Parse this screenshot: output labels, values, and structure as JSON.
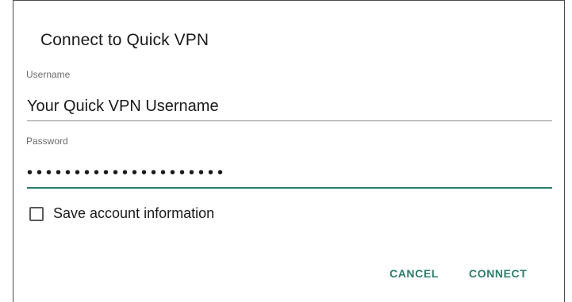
{
  "dialog": {
    "title": "Connect to Quick VPN",
    "username": {
      "label": "Username",
      "value": "Your Quick VPN Username"
    },
    "password": {
      "label": "Password",
      "value": "•••••••••••••••••••••"
    },
    "save_account": {
      "label": "Save account information",
      "checked": false
    },
    "buttons": {
      "cancel": "CANCEL",
      "connect": "CONNECT"
    },
    "colors": {
      "accent": "#2e7d6a"
    }
  }
}
